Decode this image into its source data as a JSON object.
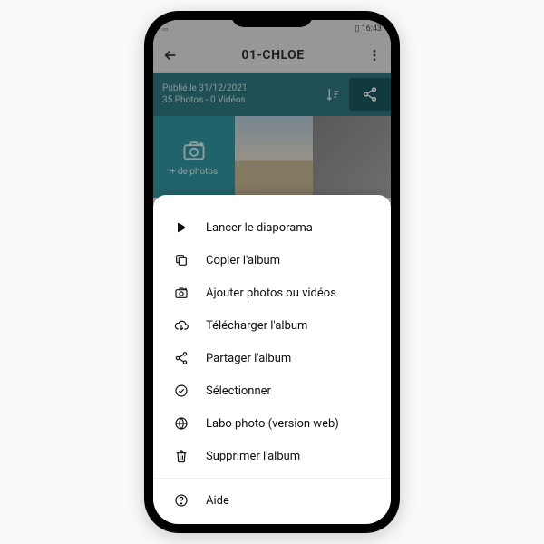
{
  "status": {
    "time": "16:43"
  },
  "topbar": {
    "title": "01-CHLOE"
  },
  "infobar": {
    "published": "Publié le 31/12/2021",
    "counts": "35 Photos - 0 Vidéos"
  },
  "gallery": {
    "add_label": "+ de photos"
  },
  "menu": {
    "slideshow": "Lancer le diaporama",
    "copy": "Copier l'album",
    "add": "Ajouter photos ou vidéos",
    "download": "Télécharger l'album",
    "share": "Partager l'album",
    "select": "Sélectionner",
    "lab": "Labo photo (version web)",
    "delete": "Supprimer l'album",
    "help": "Aide"
  }
}
